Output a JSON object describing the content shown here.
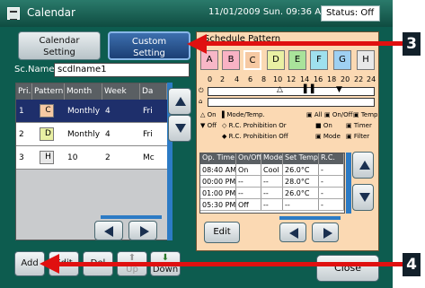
{
  "window": {
    "title": "Calendar",
    "datetime": "11/01/2009 Sun. 09:36 AM",
    "status": "Status: Off"
  },
  "tabs": [
    {
      "label_line1": "Calendar",
      "label_line2": "Setting"
    },
    {
      "label_line1": "Custom",
      "label_line2": "Setting"
    }
  ],
  "left": {
    "sc_name_label": "Sc.Name",
    "sc_name_value": "scdlname1",
    "headers": [
      "Pri.",
      "Pattern",
      "Month",
      "Week",
      "Da"
    ],
    "rows": [
      {
        "pri": "1",
        "pattern": "C",
        "month": "Monthly",
        "week": "4",
        "day": "Fri"
      },
      {
        "pri": "2",
        "pattern": "D",
        "month": "Monthly",
        "week": "4",
        "day": "Fri"
      },
      {
        "pri": "3",
        "pattern": "H",
        "month": "10",
        "week": "2",
        "day": "Mc"
      }
    ],
    "buttons": {
      "add": "Add",
      "edit": "Edit",
      "delete": "Del",
      "up": "Up",
      "down": "Down"
    }
  },
  "right": {
    "title": "Schedule Pattern",
    "pattern_buttons": [
      {
        "label": "A",
        "color": "#f7b7c7"
      },
      {
        "label": "B",
        "color": "#f9b2c4"
      },
      {
        "label": "C",
        "color": "#f6c9a3"
      },
      {
        "label": "D",
        "color": "#e9f0a3"
      },
      {
        "label": "E",
        "color": "#a9e39b"
      },
      {
        "label": "F",
        "color": "#9fe0ee"
      },
      {
        "label": "G",
        "color": "#9fd0f2"
      },
      {
        "label": "H",
        "color": "#e8e8e8"
      }
    ],
    "timeline_hours": [
      "0",
      "2",
      "4",
      "6",
      "8",
      "10",
      "12",
      "14",
      "16",
      "18",
      "20",
      "22",
      "24"
    ],
    "legend": {
      "on": "On",
      "mode_temp": "Mode/Temp.",
      "all": "All",
      "on_off": "On/Off",
      "temp": "Temp",
      "off": "Off",
      "rc_prohibition_or": "R.C. Prohibition Or",
      "on2": "On",
      "timer": "Timer",
      "rc_prohibition_off": "R.C. Prohibition Off",
      "mode": "Mode",
      "filter": "Filter"
    },
    "op_headers": [
      "Op. Time",
      "On/Off",
      "Mode",
      "Set Temp",
      "R.C."
    ],
    "op_rows": [
      [
        "08:40 AM",
        "On",
        "Cool",
        "26.0°C",
        "-"
      ],
      [
        "00:00 PM",
        "--",
        "--",
        "28.0°C",
        "-"
      ],
      [
        "01:00 PM",
        "--",
        "--",
        "26.0°C",
        "-"
      ],
      [
        "05:30 PM",
        "Off",
        "--",
        "--",
        "-"
      ]
    ],
    "edit": "Edit"
  },
  "close": "Close",
  "callouts": {
    "three": "3",
    "four": "4"
  },
  "colors": {
    "frame": "#0d5c4f",
    "callout_red": "#e01010",
    "panel": "#fbd9b3"
  }
}
